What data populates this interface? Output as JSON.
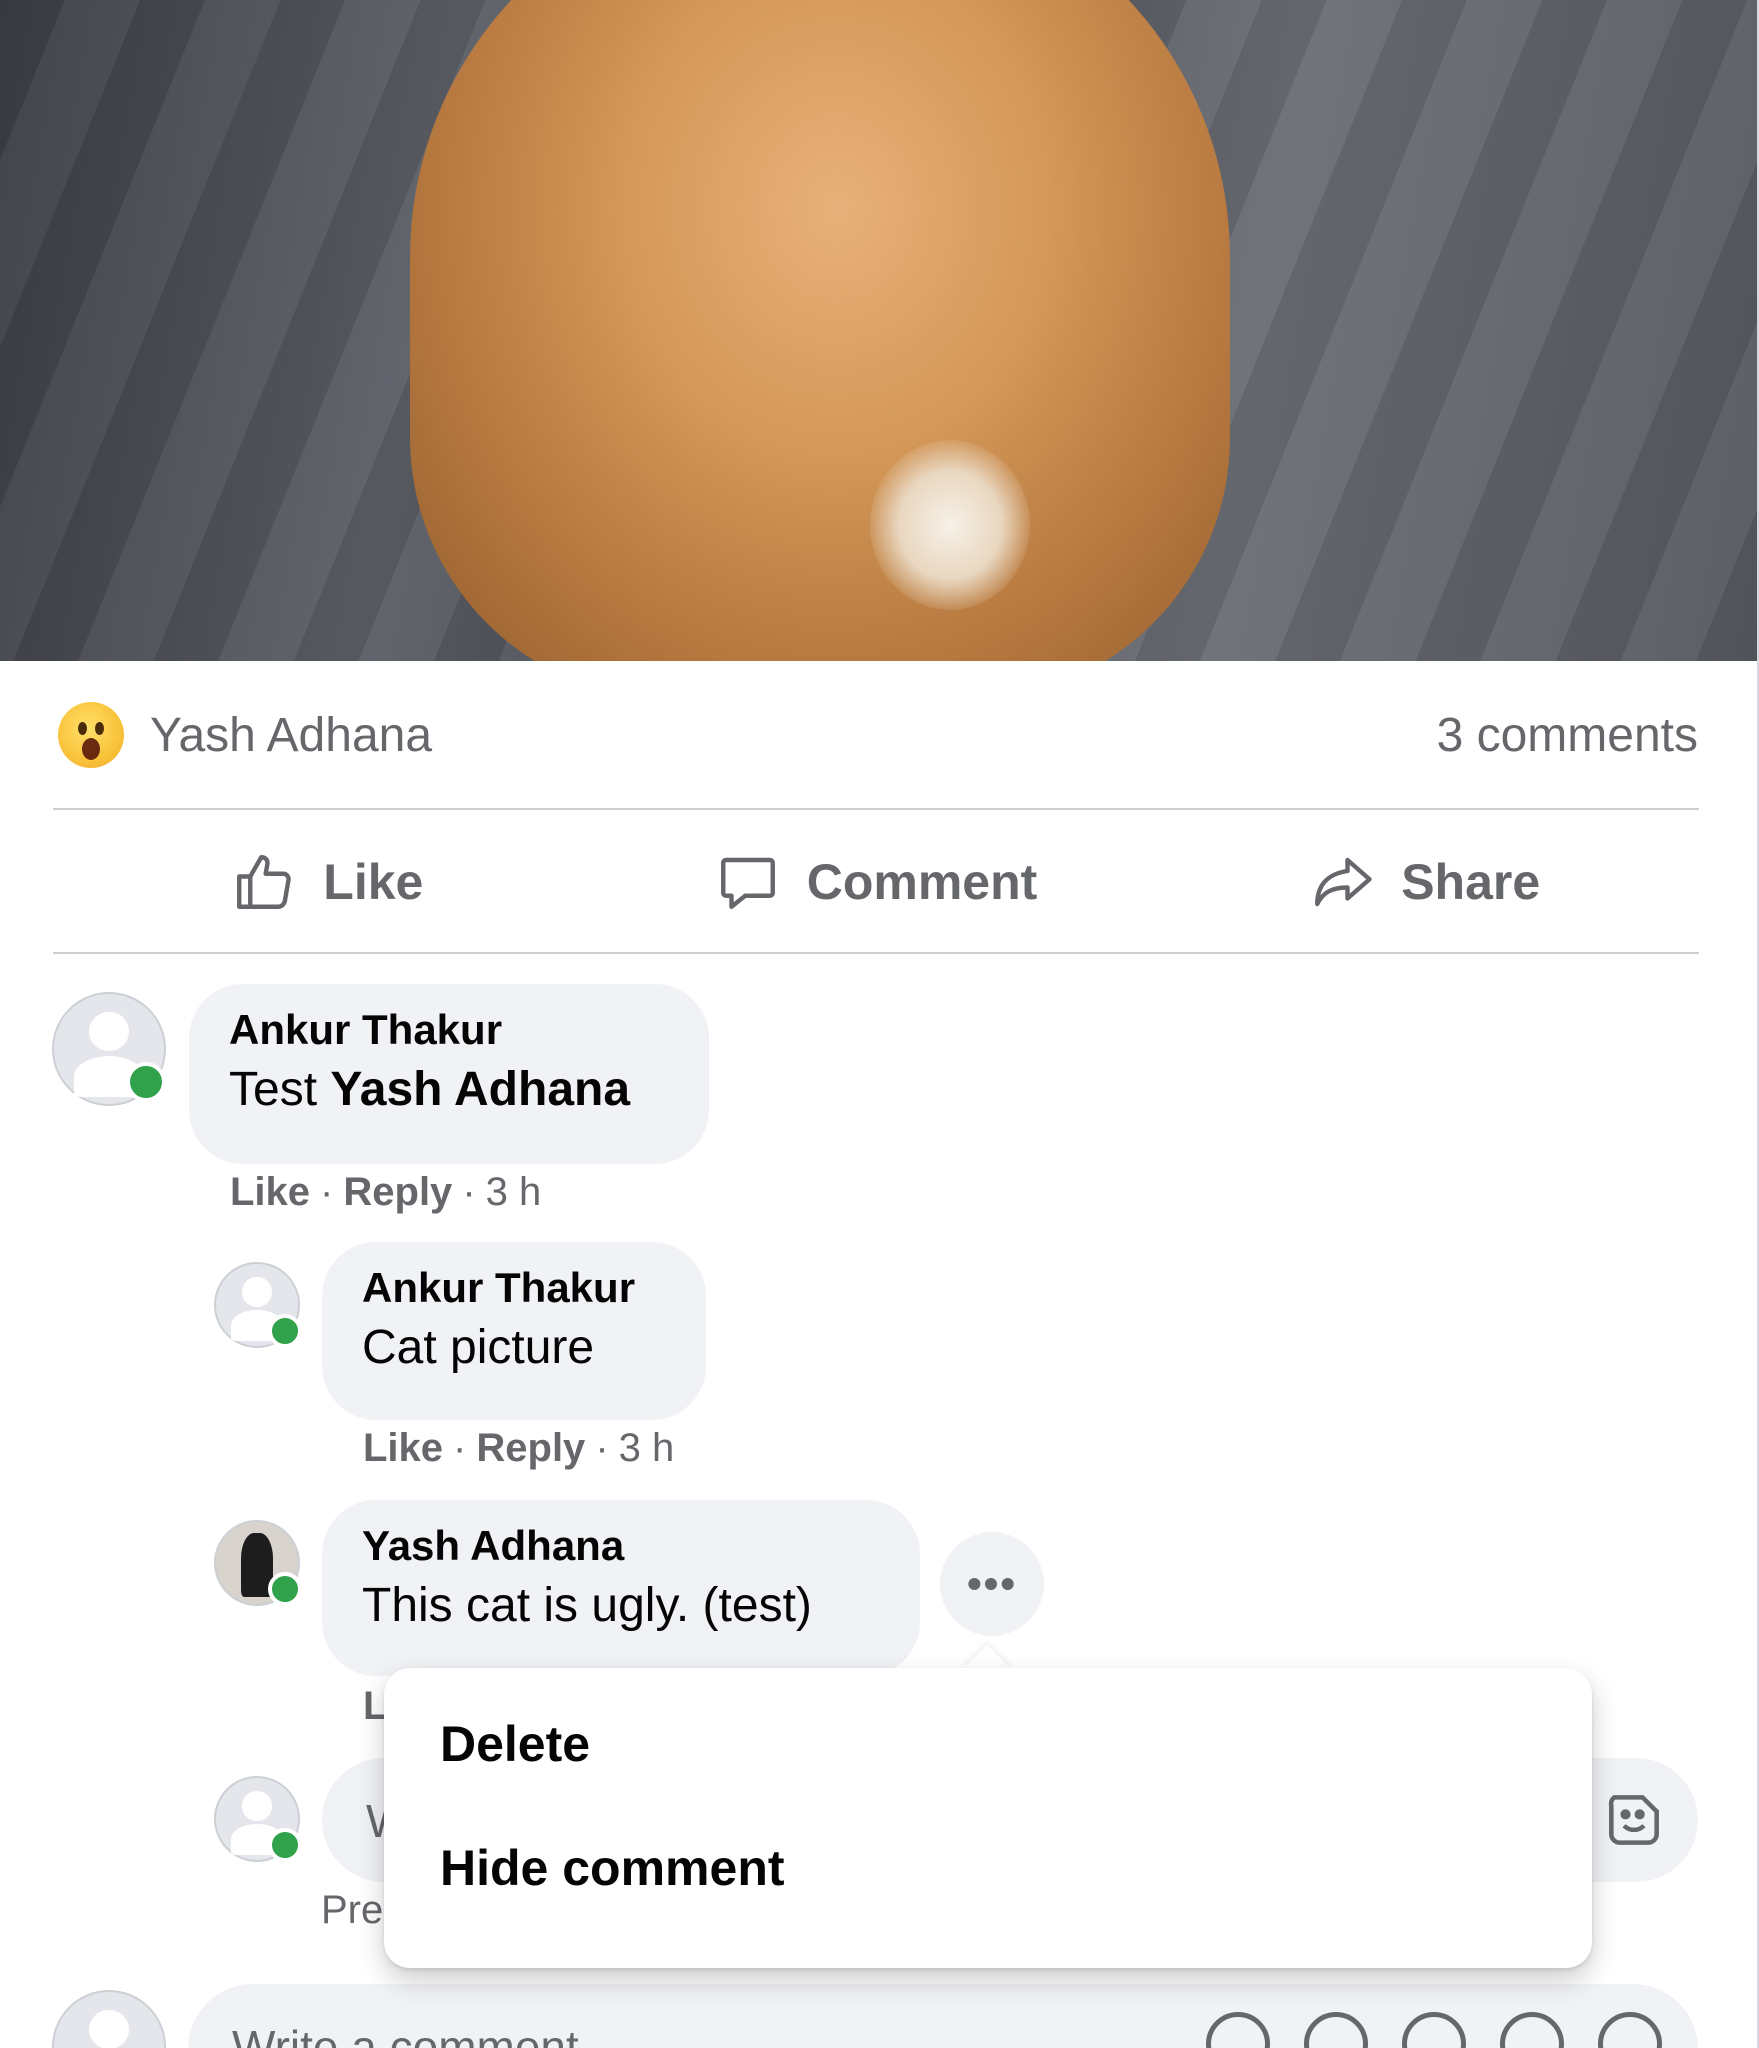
{
  "post": {
    "reaction_emoji": "surprised-face-emoji",
    "reactor_name": "Yash Adhana",
    "comment_count": "3 comments"
  },
  "actions": {
    "like": "Like",
    "comment": "Comment",
    "share": "Share"
  },
  "comments": [
    {
      "author": "Ankur Thakur",
      "text_prefix": "Test ",
      "text_mention": "Yash Adhana",
      "like": "Like",
      "reply": "Reply",
      "time": "3 h"
    },
    {
      "author": "Ankur Thakur",
      "text": "Cat picture",
      "like": "Like",
      "reply": "Reply",
      "time": "3 h"
    },
    {
      "author": "Yash Adhana",
      "text": "This cat is ugly. (test)",
      "like_partial": "L"
    }
  ],
  "reply_box": {
    "placeholder_partial": "W",
    "hint_partial": "Pre"
  },
  "main_input": {
    "placeholder": "Write a comment..."
  },
  "menu": {
    "more_label": "•••",
    "items": [
      "Delete",
      "Hide comment"
    ]
  },
  "colors": {
    "online": "#31a24c",
    "bubble": "#f0f2f5",
    "secondary_text": "#65676b"
  }
}
